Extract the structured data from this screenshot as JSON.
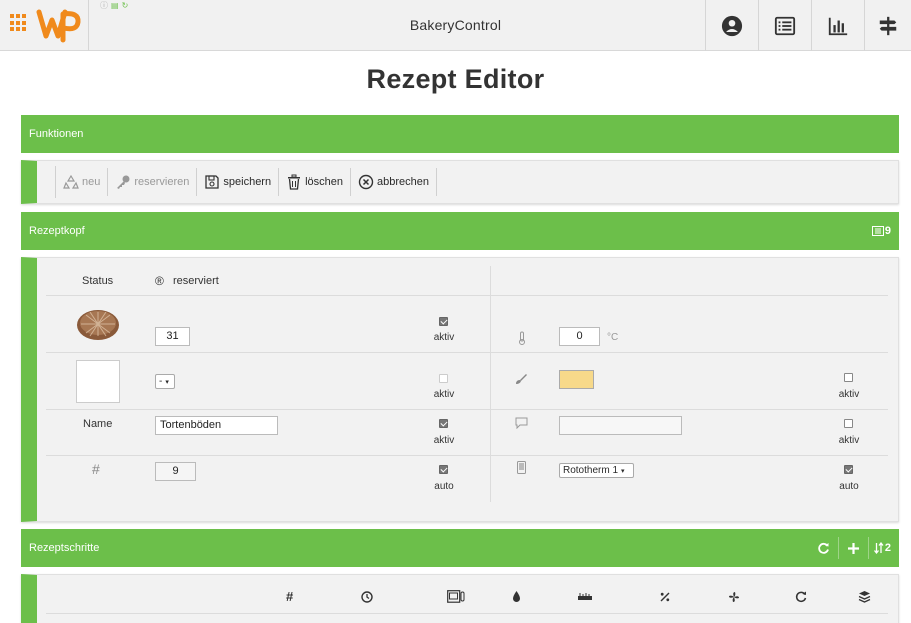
{
  "app": {
    "title": "BakeryControl"
  },
  "page": {
    "title": "Rezept Editor"
  },
  "sections": {
    "funktionen": "Funktionen",
    "rezeptkopf": "Rezeptkopf",
    "rezeptkopf_count": "9",
    "rezeptschritte": "Rezeptschritte",
    "rezeptschritte_count": "2"
  },
  "toolbar": {
    "neu": "neu",
    "reservieren": "reservieren",
    "speichern": "speichern",
    "loeschen": "löschen",
    "abbrechen": "abbrechen"
  },
  "header_form": {
    "status_label": "Status",
    "status_symbol": "®",
    "status_value": "reserviert",
    "image_number": "31",
    "image_active_label": "aktiv",
    "temperature_value": "0",
    "temperature_unit": "°C",
    "small_select_value": "-",
    "small_select_active_label": "aktiv",
    "color_active_label": "aktiv",
    "name_label": "Name",
    "name_value": "Tortenböden",
    "name_active_label": "aktiv",
    "comment_value": "",
    "comment_active_label": "aktiv",
    "number_symbol": "#",
    "number_value": "9",
    "number_auto_label": "auto",
    "device_value": "Rototherm 1",
    "device_auto_label": "auto"
  },
  "colors": {
    "green": "#6cbf4a",
    "orange": "#f08a1c",
    "color_swatch": "#f7d98a"
  },
  "steps_header": {
    "columns": [
      "#",
      "clock-icon",
      "oven-icon",
      "drop-icon",
      "ruler-icon",
      "percent-icon",
      "fan-icon",
      "refresh-icon",
      "layers-icon"
    ]
  }
}
